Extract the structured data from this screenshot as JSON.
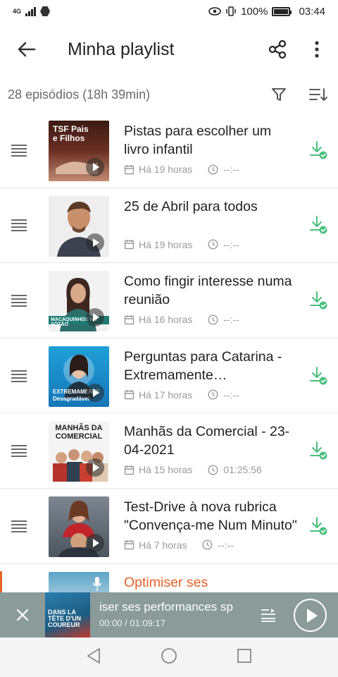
{
  "status_bar": {
    "network": "4G",
    "battery_level": 1.0,
    "battery_text": "100%",
    "time": "03:44"
  },
  "toolbar": {
    "title": "Minha playlist",
    "back_icon": "arrow-left-icon",
    "share_icon": "share-icon",
    "more_icon": "more-vertical-icon"
  },
  "summary": {
    "count_text": "28 episódios (18h 39min)",
    "filter_icon": "filter-icon",
    "sort_icon": "sort-icon"
  },
  "colors": {
    "accent": "#e8622b",
    "download_green": "#4bbf7e",
    "player_bg": "#8b9b99",
    "meta_gray": "#9a9a9a"
  },
  "episodes": [
    {
      "title": "Pistas para escolher um livro infantil",
      "date": "Há 19 horas",
      "duration": "--:--",
      "thumb_text": "TSF Pais e Filhos"
    },
    {
      "title": "25 de Abril para todos",
      "date": "Há 19 horas",
      "duration": "--:--",
      "thumb_text": ""
    },
    {
      "title": "Como fingir interesse numa reunião",
      "date": "Há 16 horas",
      "duration": "--:--",
      "thumb_text": "MACAQUINHOS NO SÓTÃO"
    },
    {
      "title": "Perguntas para Catarina - Extremamente Desagradável",
      "date": "Há 17 horas",
      "duration": "--:--",
      "thumb_text": "EXTREMAMENTE Desagradável"
    },
    {
      "title": "Manhãs da Comercial - 23-04-2021",
      "date": "Há 15 horas",
      "duration": "01:25:56",
      "thumb_text": "MANHÃS DA COMERCIAL"
    },
    {
      "title": "Test-Drive à nova rubrica \"Convença-me Num Minuto\"",
      "date": "Há 7 horas",
      "duration": "--:--",
      "thumb_text": ""
    }
  ],
  "partial_episode": {
    "title": "Optimiser ses"
  },
  "player": {
    "title": "iser ses performances sp",
    "time": "00:00 / 01:09:17",
    "cover_text": "DANS LA TÊTE D'UN COUREUR"
  }
}
